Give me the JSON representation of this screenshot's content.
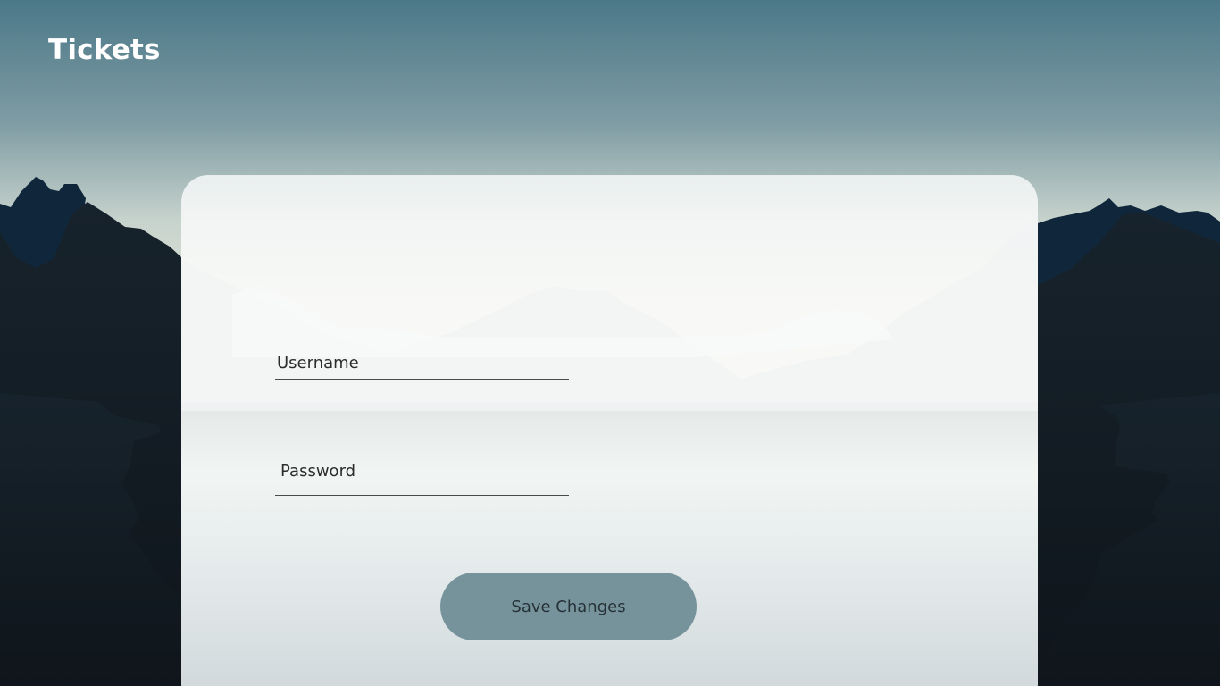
{
  "app": {
    "title": "Tickets"
  },
  "form": {
    "username_placeholder": "Username",
    "password_placeholder": "Password",
    "save_label": "Save Changes"
  },
  "colors": {
    "sky_top": "#4d7989",
    "sky_horizon": "#cfd8cd",
    "mountain_dark": "#141f28",
    "mountain_blue": "#10263a",
    "button": "#76939b",
    "card": "#ffffffc2"
  }
}
